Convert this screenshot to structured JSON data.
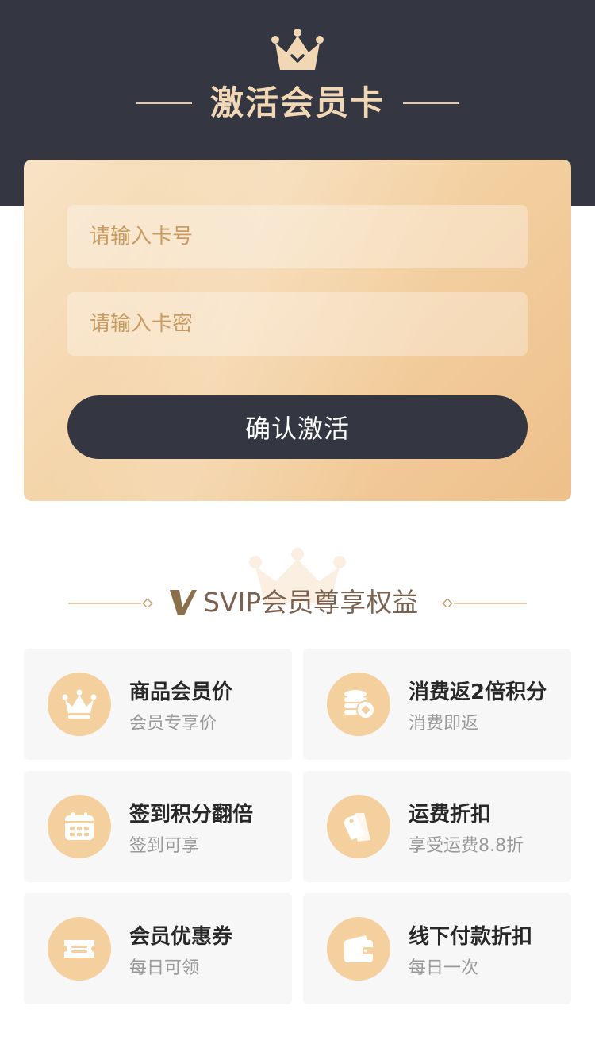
{
  "header": {
    "title": "激活会员卡",
    "icon": "crown-icon"
  },
  "form": {
    "card_number_placeholder": "请输入卡号",
    "card_password_placeholder": "请输入卡密",
    "confirm_label": "确认激活"
  },
  "benefits": {
    "title": "SVIP会员尊享权益",
    "items": [
      {
        "title": "商品会员价",
        "subtitle": "会员专享价",
        "icon": "crown-icon"
      },
      {
        "title": "消费返2倍积分",
        "subtitle": "消费即返",
        "icon": "coins-icon"
      },
      {
        "title": "签到积分翻倍",
        "subtitle": "签到可享",
        "icon": "calendar-icon"
      },
      {
        "title": "运费折扣",
        "subtitle": "享受运费8.8折",
        "icon": "tag-icon"
      },
      {
        "title": "会员优惠券",
        "subtitle": "每日可领",
        "icon": "coupon-icon"
      },
      {
        "title": "线下付款折扣",
        "subtitle": "每日一次",
        "icon": "wallet-icon"
      }
    ]
  },
  "colors": {
    "header_bg": "#343641",
    "accent_gold": "#f1d7b3",
    "icon_circle": "#f5d09f",
    "card_gradient_start": "#f8e3c6",
    "card_gradient_end": "#eec08a"
  }
}
